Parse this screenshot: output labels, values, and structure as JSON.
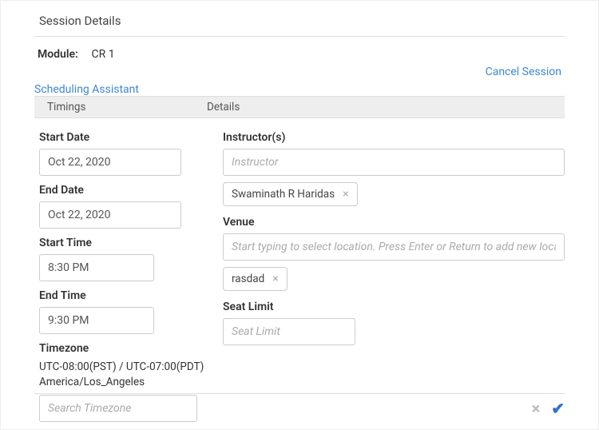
{
  "title": "Session Details",
  "module_label": "Module:",
  "module_value": "CR 1",
  "cancel_session": "Cancel Session",
  "scheduling_assistant": "Scheduling Assistant",
  "tabs": {
    "timings": "Timings",
    "details": "Details"
  },
  "timings": {
    "start_date_label": "Start Date",
    "start_date_value": "Oct 22, 2020",
    "end_date_label": "End Date",
    "end_date_value": "Oct 22, 2020",
    "start_time_label": "Start Time",
    "start_time_value": "8:30 PM",
    "end_time_label": "End Time",
    "end_time_value": "9:30 PM",
    "timezone_label": "Timezone",
    "timezone_text": "UTC-08:00(PST) / UTC-07:00(PDT) America/Los_Angeles",
    "timezone_placeholder": "Search Timezone"
  },
  "details": {
    "instructors_label": "Instructor(s)",
    "instructor_placeholder": "Instructor",
    "instructor_chip": "Swaminath R Haridas",
    "venue_label": "Venue",
    "venue_placeholder": "Start typing to select location. Press Enter or Return to add new location",
    "venue_chip": "rasdad",
    "seat_limit_label": "Seat Limit",
    "seat_limit_placeholder": "Seat Limit"
  },
  "icons": {
    "close": "×",
    "check": "✔"
  }
}
